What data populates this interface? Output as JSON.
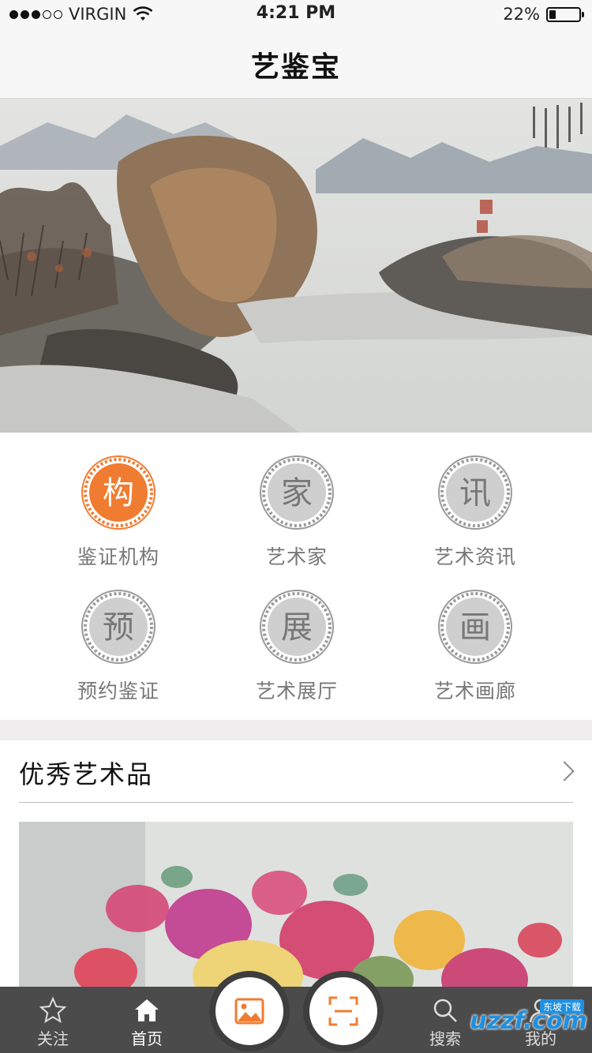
{
  "status_bar": {
    "carrier": "VIRGIN",
    "time": "4:21 PM",
    "battery_text": "22%",
    "battery_level": 0.22,
    "signal_dots_filled": 3,
    "signal_dots_total": 5
  },
  "nav": {
    "title": "艺鉴宝"
  },
  "banner": {
    "page_count": 3,
    "active_page": 1
  },
  "categories": [
    {
      "glyph": "构",
      "label": "鉴证机构",
      "active": true,
      "icon": "seal-icon"
    },
    {
      "glyph": "家",
      "label": "艺术家",
      "active": false,
      "icon": "seal-icon"
    },
    {
      "glyph": "讯",
      "label": "艺术资讯",
      "active": false,
      "icon": "seal-icon"
    },
    {
      "glyph": "预",
      "label": "预约鉴证",
      "active": false,
      "icon": "seal-icon"
    },
    {
      "glyph": "展",
      "label": "艺术展厅",
      "active": false,
      "icon": "seal-icon"
    },
    {
      "glyph": "画",
      "label": "艺术画廊",
      "active": false,
      "icon": "seal-icon"
    }
  ],
  "featured": {
    "title": "优秀艺术品"
  },
  "tabs": [
    {
      "label": "关注",
      "icon": "star-icon",
      "active": false
    },
    {
      "label": "首页",
      "icon": "home-icon",
      "active": true
    },
    {
      "label": "搜索",
      "icon": "search-icon",
      "active": false
    },
    {
      "label": "我的",
      "icon": "profile-icon",
      "active": false
    }
  ],
  "center_buttons": [
    {
      "icon": "image-icon"
    },
    {
      "icon": "scan-icon"
    }
  ],
  "watermark": {
    "text": "uzzf.com",
    "badge": "东坡下载"
  },
  "colors": {
    "accent": "#f07c31",
    "inactive_seal": "#cfcfcf",
    "tab_bar": "#4b4b4b",
    "label_gray": "#777777"
  }
}
